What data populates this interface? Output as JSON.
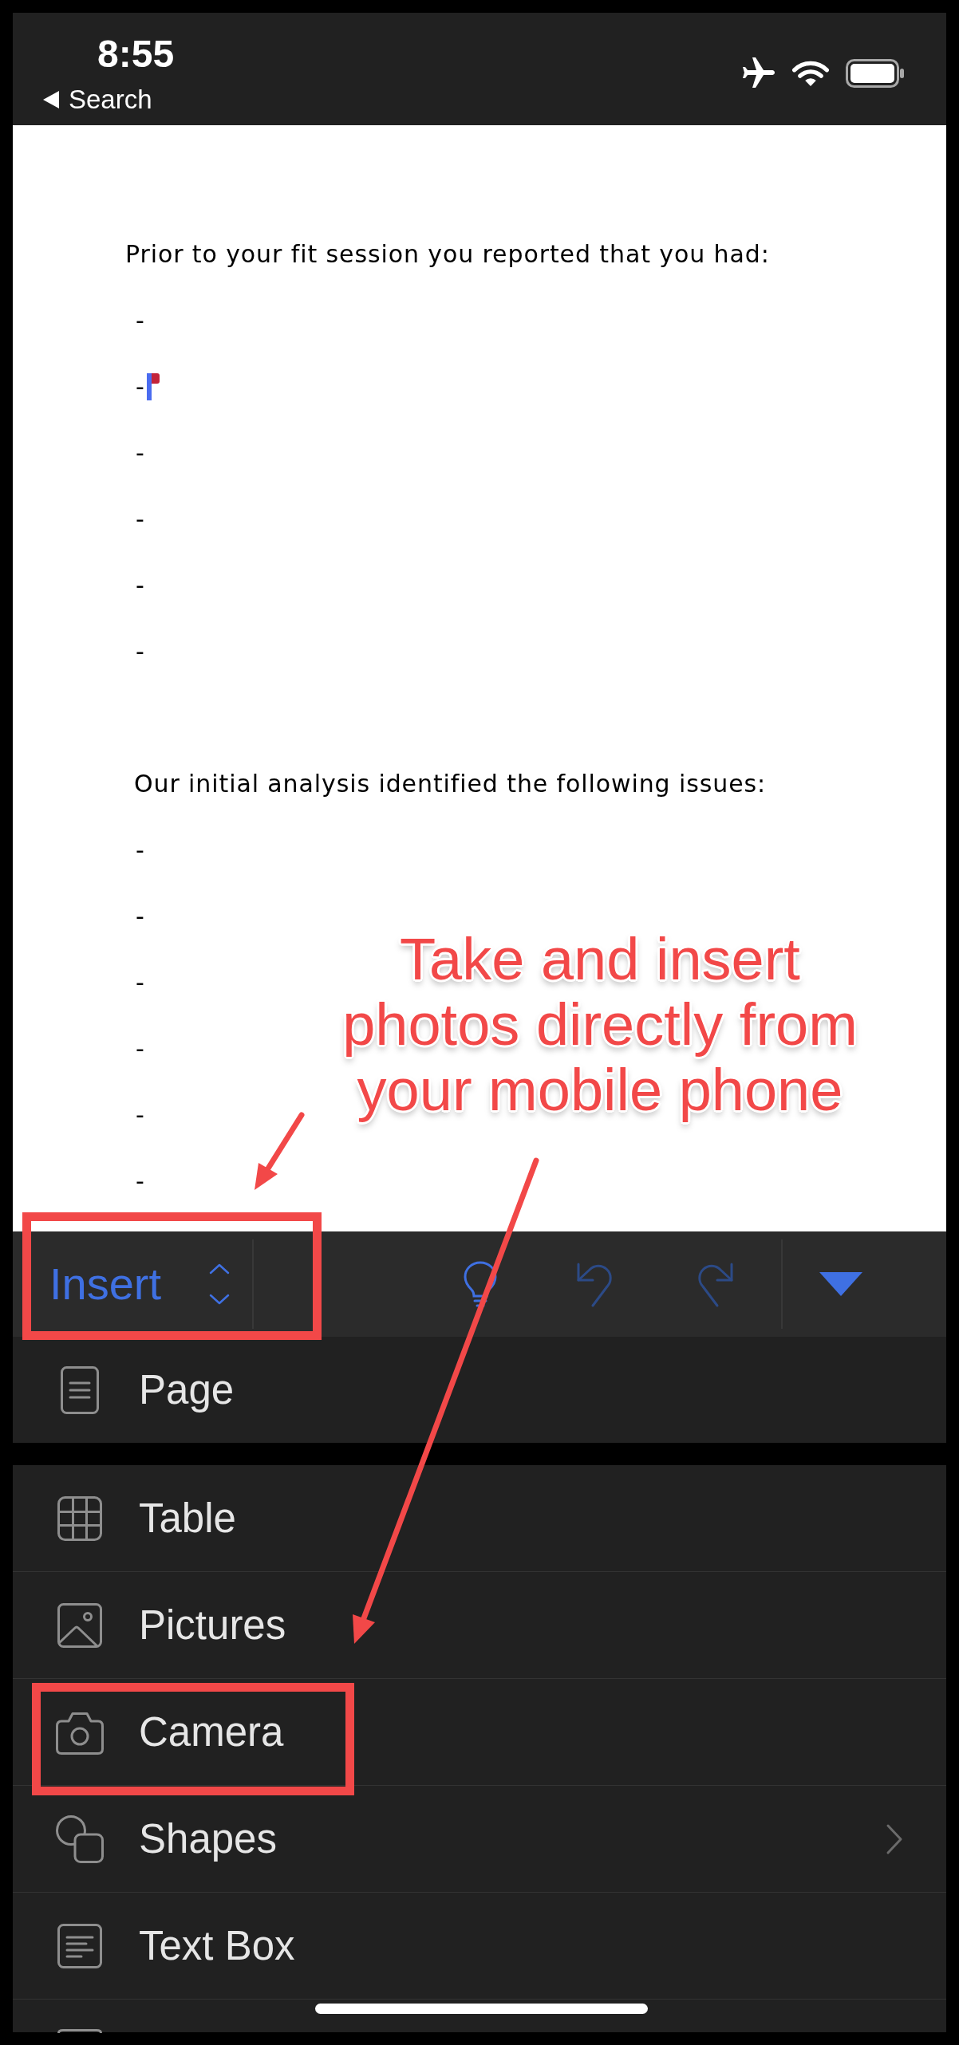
{
  "status_bar": {
    "time": "8:55",
    "back_label": "Search"
  },
  "document": {
    "sections": [
      {
        "intro": "Prior to your fit session you reported that you had:",
        "items": [
          {
            "text": "-",
            "cursor": false
          },
          {
            "text": "-",
            "cursor": true
          },
          {
            "text": "-",
            "cursor": false
          },
          {
            "text": "-",
            "cursor": false
          },
          {
            "text": "-",
            "cursor": false
          },
          {
            "text": "-",
            "cursor": false
          }
        ]
      },
      {
        "intro": "Our initial analysis identified the following issues:",
        "items": [
          {
            "text": "-",
            "cursor": false
          },
          {
            "text": "-",
            "cursor": false
          },
          {
            "text": "-",
            "cursor": false
          },
          {
            "text": "-",
            "cursor": false
          },
          {
            "text": "-",
            "cursor": false
          },
          {
            "text": "-",
            "cursor": false
          }
        ]
      }
    ]
  },
  "annotation": {
    "lines": [
      "Take and insert",
      "photos directly from",
      "your mobile phone"
    ]
  },
  "toolbar": {
    "mode": {
      "label": "Insert",
      "highlighted": true
    },
    "tools": [
      {
        "kind": "ideas",
        "disabled": false
      },
      {
        "kind": "undo",
        "disabled": true
      },
      {
        "kind": "redo",
        "disabled": true
      },
      {
        "kind": "collapse",
        "disabled": false
      }
    ]
  },
  "menu": {
    "groups": [
      {
        "items": [
          {
            "label": "Page",
            "highlighted": false,
            "submenu": false
          }
        ]
      },
      {
        "items": [
          {
            "label": "Table",
            "highlighted": false,
            "submenu": false
          },
          {
            "label": "Pictures",
            "highlighted": false,
            "submenu": false
          },
          {
            "label": "Camera",
            "highlighted": true,
            "submenu": false
          },
          {
            "label": "Shapes",
            "highlighted": false,
            "submenu": true
          },
          {
            "label": "Text Box",
            "highlighted": false,
            "submenu": false
          }
        ]
      }
    ]
  }
}
